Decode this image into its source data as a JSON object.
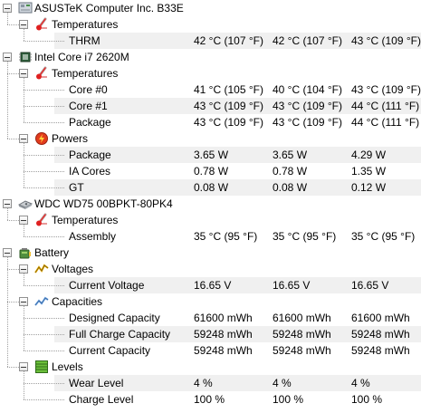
{
  "devices": [
    {
      "name": "ASUSTeK Computer Inc. B33E",
      "icon": "motherboard-icon",
      "groups": [
        {
          "name": "Temperatures",
          "icon": "thermometer-icon",
          "rows": [
            {
              "label": "THRM",
              "values": [
                "42 °C  (107 °F)",
                "42 °C  (107 °F)",
                "43 °C  (109 °F)"
              ]
            }
          ]
        }
      ]
    },
    {
      "name": "Intel Core i7 2620M",
      "icon": "cpu-chip-icon",
      "groups": [
        {
          "name": "Temperatures",
          "icon": "thermometer-icon",
          "rows": [
            {
              "label": "Core #0",
              "values": [
                "41 °C  (105 °F)",
                "40 °C  (104 °F)",
                "43 °C  (109 °F)"
              ]
            },
            {
              "label": "Core #1",
              "values": [
                "43 °C  (109 °F)",
                "43 °C  (109 °F)",
                "44 °C  (111 °F)"
              ]
            },
            {
              "label": "Package",
              "values": [
                "43 °C  (109 °F)",
                "43 °C  (109 °F)",
                "44 °C  (111 °F)"
              ]
            }
          ]
        },
        {
          "name": "Powers",
          "icon": "power-icon",
          "rows": [
            {
              "label": "Package",
              "values": [
                "3.65 W",
                "3.65 W",
                "4.29 W"
              ]
            },
            {
              "label": "IA Cores",
              "values": [
                "0.78 W",
                "0.78 W",
                "1.35 W"
              ]
            },
            {
              "label": "GT",
              "values": [
                "0.08 W",
                "0.08 W",
                "0.12 W"
              ]
            }
          ]
        }
      ]
    },
    {
      "name": "WDC WD75 00BPKT-80PK4",
      "icon": "hard-disk-icon",
      "groups": [
        {
          "name": "Temperatures",
          "icon": "thermometer-icon",
          "rows": [
            {
              "label": "Assembly",
              "values": [
                "35 °C  (95 °F)",
                "35 °C  (95 °F)",
                "35 °C  (95 °F)"
              ]
            }
          ]
        }
      ]
    },
    {
      "name": "Battery",
      "icon": "battery-icon",
      "groups": [
        {
          "name": "Voltages",
          "icon": "voltage-icon",
          "rows": [
            {
              "label": "Current Voltage",
              "values": [
                "16.65 V",
                "16.65 V",
                "16.65 V"
              ]
            }
          ]
        },
        {
          "name": "Capacities",
          "icon": "capacity-icon",
          "rows": [
            {
              "label": "Designed Capacity",
              "values": [
                "61600 mWh",
                "61600 mWh",
                "61600 mWh"
              ]
            },
            {
              "label": "Full Charge Capacity",
              "values": [
                "59248 mWh",
                "59248 mWh",
                "59248 mWh"
              ]
            },
            {
              "label": "Current Capacity",
              "values": [
                "59248 mWh",
                "59248 mWh",
                "59248 mWh"
              ]
            }
          ]
        },
        {
          "name": "Levels",
          "icon": "level-gauge-icon",
          "rows": [
            {
              "label": "Wear Level",
              "values": [
                "4 %",
                "4 %",
                "4 %"
              ]
            },
            {
              "label": "Charge Level",
              "values": [
                "100 %",
                "100 %",
                "100 %"
              ]
            }
          ]
        }
      ]
    }
  ]
}
